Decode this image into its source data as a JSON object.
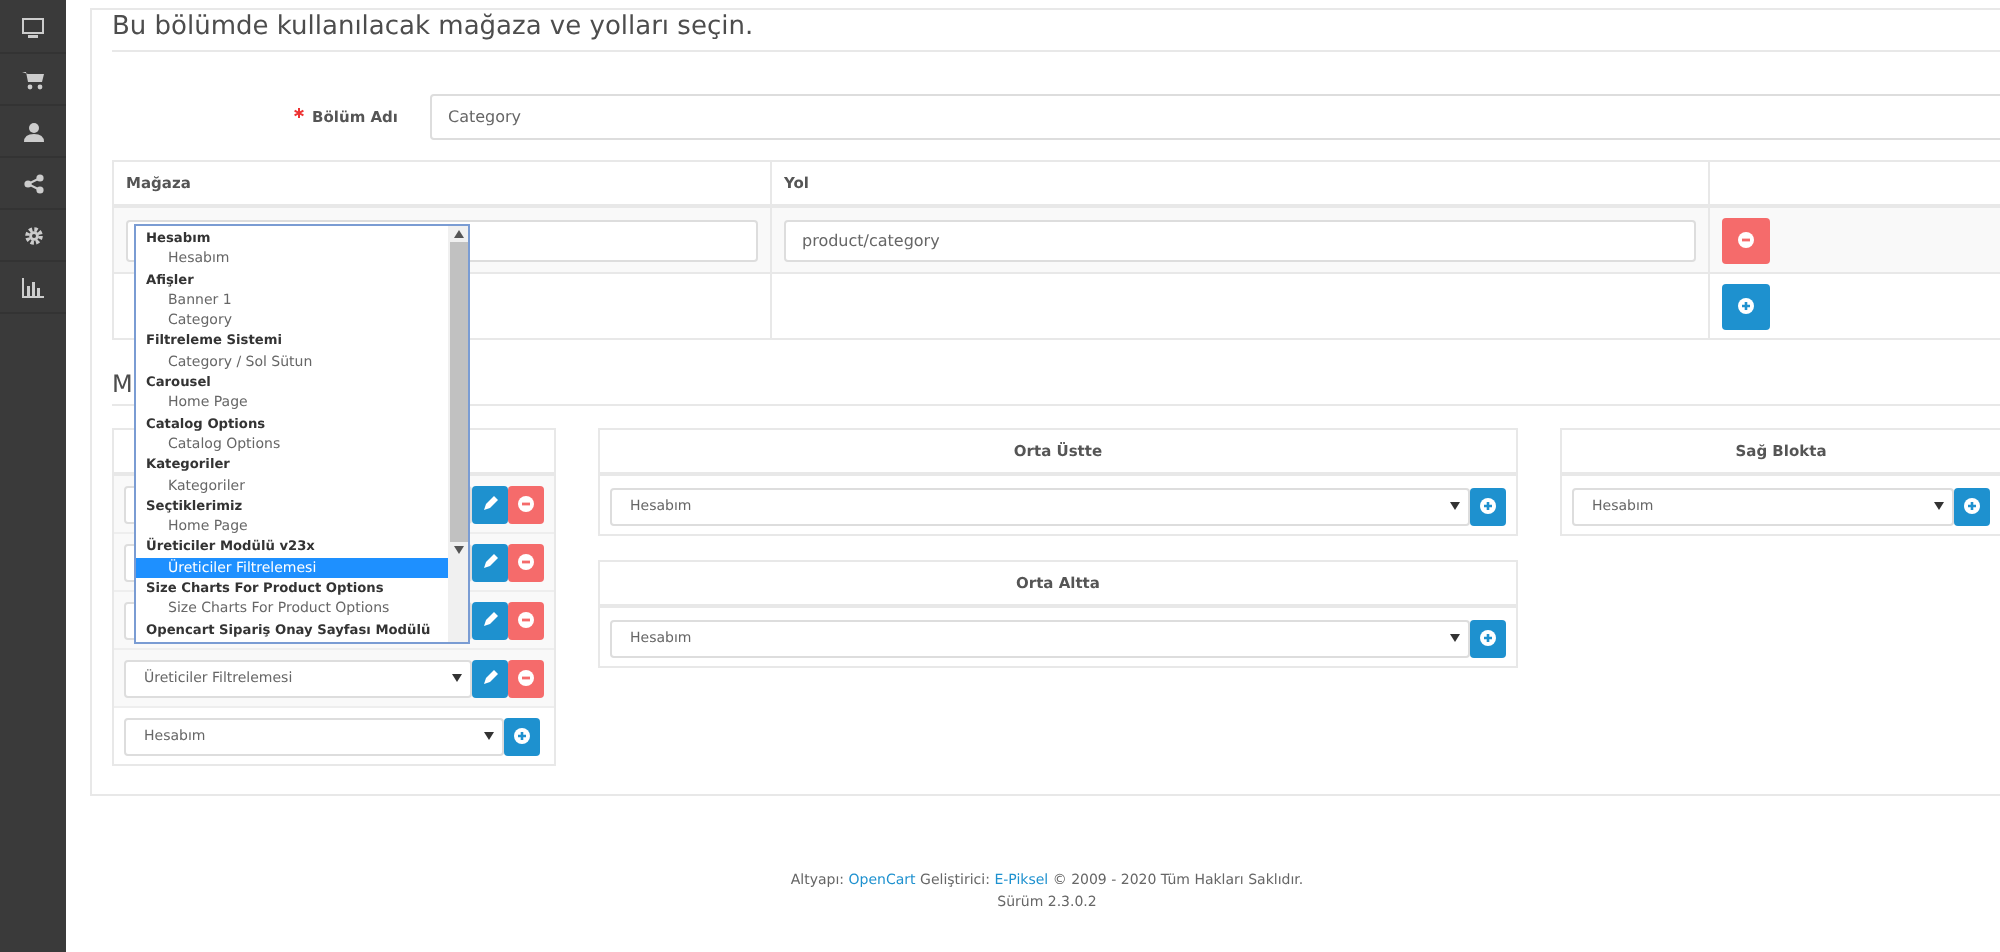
{
  "heading": "Bu bölümde kullanılacak mağaza ve yolları seçin.",
  "name_field": {
    "label": "Bölüm Adı",
    "required": true,
    "value": "Category"
  },
  "table": {
    "columns": [
      "Mağaza",
      "Yol"
    ],
    "rows": [
      {
        "path": "product/category"
      }
    ]
  },
  "section_heading": "M",
  "left_block": {
    "rows": [
      {
        "kind": "module"
      },
      {
        "kind": "module"
      },
      {
        "kind": "module"
      },
      {
        "kind": "module",
        "value": "Üreticiler Filtrelemesi"
      },
      {
        "kind": "add",
        "value": "Hesabım"
      }
    ]
  },
  "middle_blocks": [
    {
      "title": "Orta Üstte",
      "value": "Hesabım"
    },
    {
      "title": "Orta Altta",
      "value": "Hesabım"
    }
  ],
  "right_blocks": [
    {
      "title": "Sağ Blokta",
      "value": "Hesabım"
    }
  ],
  "dropdown": {
    "groups": [
      {
        "label": "Hesabım",
        "options": [
          {
            "label": "Hesabım",
            "selected": false
          }
        ]
      },
      {
        "label": "Afişler",
        "options": [
          {
            "label": "Banner 1",
            "selected": false
          },
          {
            "label": "Category",
            "selected": false
          }
        ]
      },
      {
        "label": "Filtreleme Sistemi",
        "options": [
          {
            "label": "Category / Sol Sütun",
            "selected": false
          }
        ]
      },
      {
        "label": "Carousel",
        "options": [
          {
            "label": "Home Page",
            "selected": false
          }
        ]
      },
      {
        "label": "Catalog Options",
        "options": [
          {
            "label": "Catalog Options",
            "selected": false
          }
        ]
      },
      {
        "label": "Kategoriler",
        "options": [
          {
            "label": "Kategoriler",
            "selected": false
          }
        ]
      },
      {
        "label": "Seçtiklerimiz",
        "options": [
          {
            "label": "Home Page",
            "selected": false
          }
        ]
      },
      {
        "label": "Üreticiler Modülü v23x",
        "options": [
          {
            "label": "Üreticiler Filtrelemesi",
            "selected": true
          }
        ]
      },
      {
        "label": "Size Charts For Product Options",
        "options": [
          {
            "label": "Size Charts For Product Options",
            "selected": false
          }
        ]
      },
      {
        "label": "Opencart Sipariş Onay Sayfası Modülü"
      }
    ]
  },
  "footer": {
    "parts": [
      {
        "kind": "text",
        "text": "Altyapı:"
      },
      {
        "kind": "link",
        "text": "OpenCart"
      },
      {
        "kind": "text",
        "text": "Geliştirici:"
      },
      {
        "kind": "link",
        "text": "E-Piksel"
      },
      {
        "kind": "text",
        "text": "© 2009 - 2020 Tüm Hakları Saklıdır."
      }
    ],
    "version": "Sürüm 2.3.0.2"
  }
}
